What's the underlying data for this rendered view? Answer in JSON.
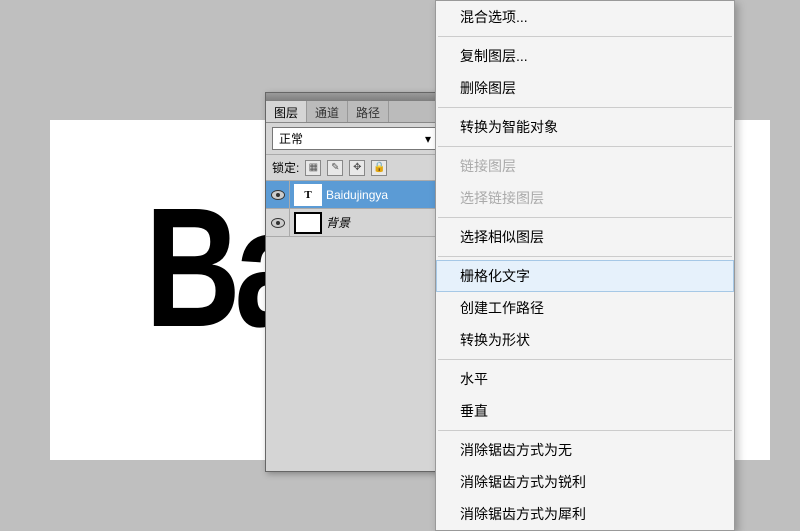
{
  "canvas": {
    "text": "Bai"
  },
  "panel": {
    "tabs": [
      "图层",
      "通道",
      "路径"
    ],
    "blend_mode": "正常",
    "lock_label": "锁定:",
    "layers": [
      {
        "thumb": "T",
        "name": "Baidujingya",
        "selected": true
      },
      {
        "thumb": "",
        "name": "背景",
        "selected": false
      }
    ]
  },
  "menu": {
    "items": [
      {
        "label": "混合选项...",
        "type": "item"
      },
      {
        "type": "sep"
      },
      {
        "label": "复制图层...",
        "type": "item"
      },
      {
        "label": "删除图层",
        "type": "item"
      },
      {
        "type": "sep"
      },
      {
        "label": "转换为智能对象",
        "type": "item"
      },
      {
        "type": "sep"
      },
      {
        "label": "链接图层",
        "type": "item",
        "disabled": true
      },
      {
        "label": "选择链接图层",
        "type": "item",
        "disabled": true
      },
      {
        "type": "sep"
      },
      {
        "label": "选择相似图层",
        "type": "item"
      },
      {
        "type": "sep"
      },
      {
        "label": "栅格化文字",
        "type": "item",
        "highlighted": true
      },
      {
        "label": "创建工作路径",
        "type": "item"
      },
      {
        "label": "转换为形状",
        "type": "item"
      },
      {
        "type": "sep"
      },
      {
        "label": "水平",
        "type": "item"
      },
      {
        "label": "垂直",
        "type": "item"
      },
      {
        "type": "sep"
      },
      {
        "label": "消除锯齿方式为无",
        "type": "item"
      },
      {
        "label": "消除锯齿方式为锐利",
        "type": "item"
      },
      {
        "label": "消除锯齿方式为犀利",
        "type": "item"
      }
    ]
  }
}
